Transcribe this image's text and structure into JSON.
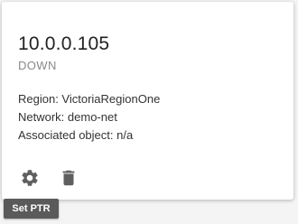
{
  "card": {
    "ip_address": "10.0.0.105",
    "status": "DOWN",
    "region": "Region: VictoriaRegionOne",
    "network": "Network: demo-net",
    "associated_object": "Associated object: n/a"
  },
  "actions": {
    "settings_icon": "gear-icon",
    "delete_icon": "trash-icon",
    "icon_color": "#5f5f5f"
  },
  "tooltip": {
    "label": "Set PTR"
  }
}
